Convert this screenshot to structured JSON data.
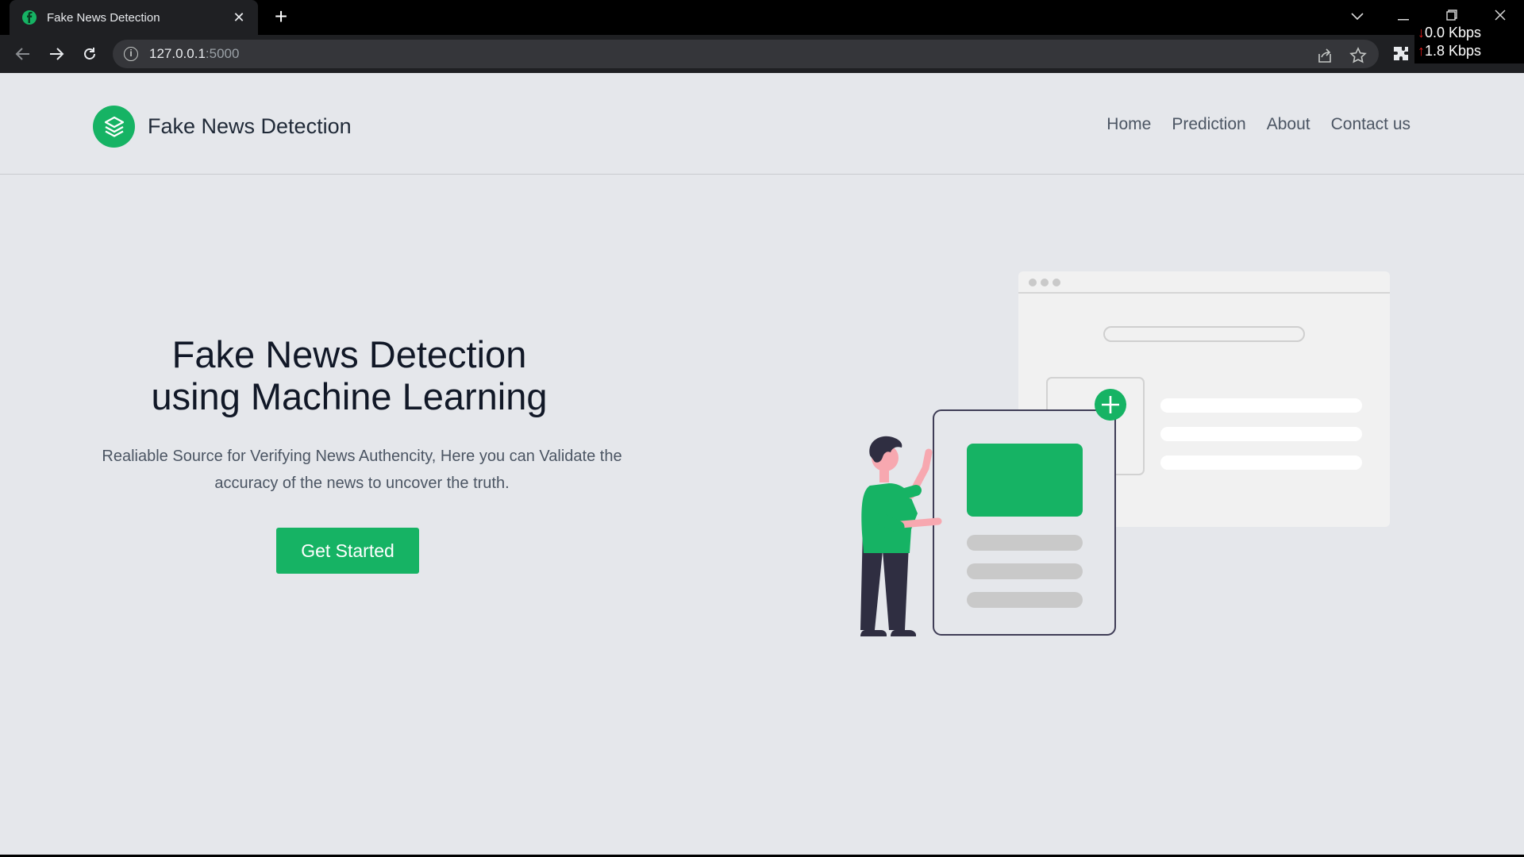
{
  "browser": {
    "tab_title": "Fake News Detection",
    "url_host": "127.0.0.1",
    "url_port": ":5000",
    "network": {
      "down": "0.0 Kbps",
      "up": "1.8 Kbps"
    }
  },
  "site": {
    "brand": "Fake News Detection",
    "nav": [
      "Home",
      "Prediction",
      "About",
      "Contact us"
    ]
  },
  "hero": {
    "title_line1": "Fake News Detection",
    "title_line2": "using Machine Learning",
    "subtitle_line1": "Realiable Source for Verifying News Authencity, Here you can Validate the",
    "subtitle_line2": "accuracy of the news to uncover the truth.",
    "cta": "Get Started"
  },
  "colors": {
    "accent": "#16b364",
    "page_bg": "#e5e7eb",
    "chrome_bg": "#1f2023"
  }
}
